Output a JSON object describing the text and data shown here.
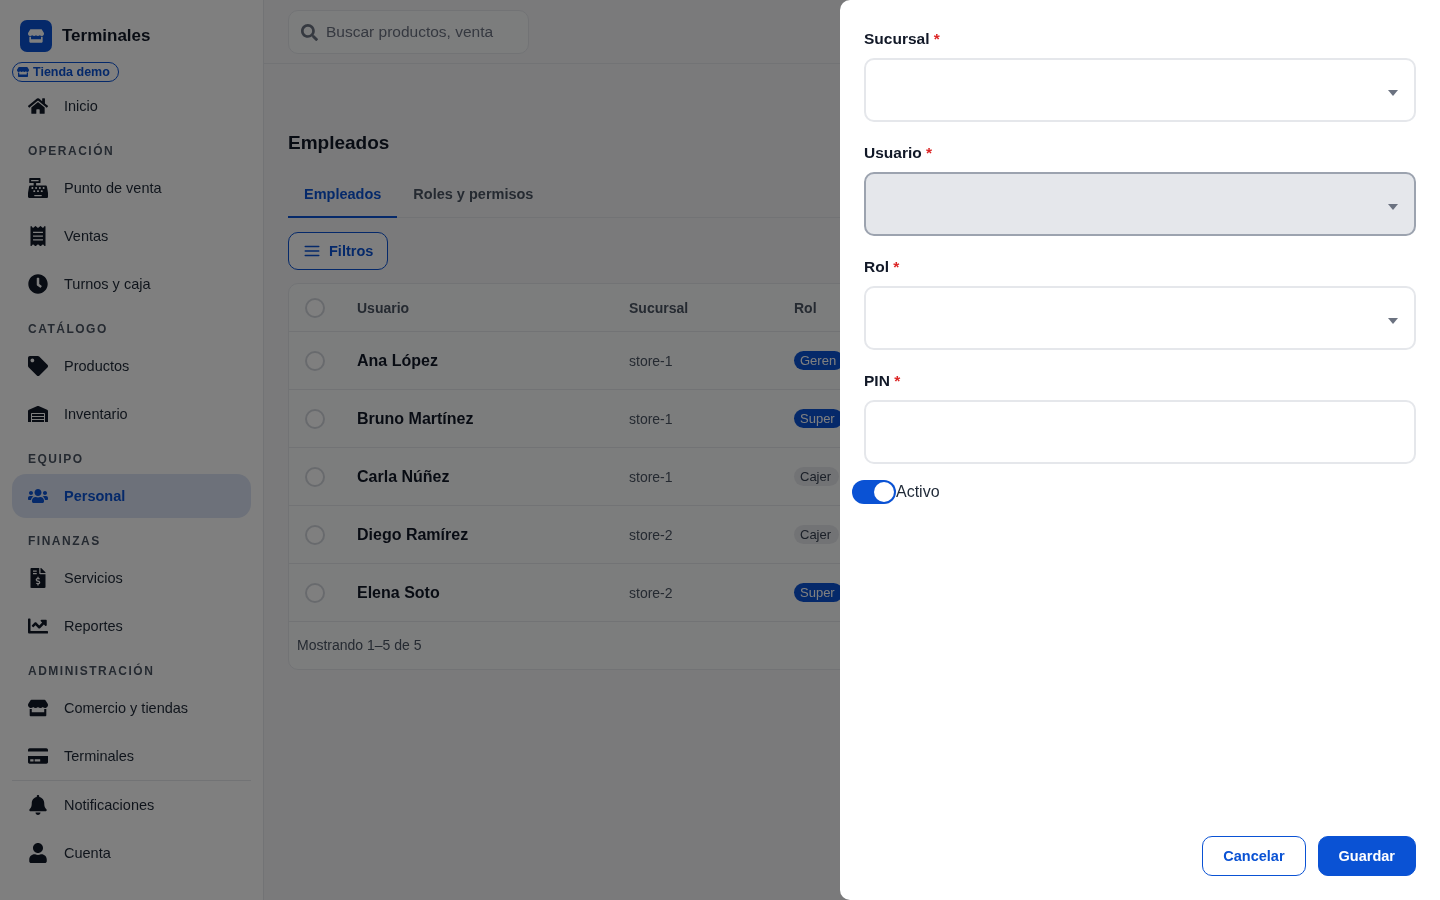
{
  "sidebar": {
    "brand": "Terminales",
    "store_chip": "Tienda demo",
    "top_items": [
      {
        "label": "Inicio",
        "selected": false
      }
    ],
    "sections": [
      {
        "heading": "OPERACIÓN",
        "items": [
          {
            "label": "Punto de venta",
            "selected": false
          },
          {
            "label": "Ventas",
            "selected": false
          },
          {
            "label": "Turnos y caja",
            "selected": false
          }
        ]
      },
      {
        "heading": "CATÁLOGO",
        "items": [
          {
            "label": "Productos",
            "selected": false
          },
          {
            "label": "Inventario",
            "selected": false
          }
        ]
      },
      {
        "heading": "EQUIPO",
        "items": [
          {
            "label": "Personal",
            "selected": true
          }
        ]
      },
      {
        "heading": "FINANZAS",
        "items": [
          {
            "label": "Servicios",
            "selected": false
          },
          {
            "label": "Reportes",
            "selected": false
          }
        ]
      },
      {
        "heading": "ADMINISTRACIÓN",
        "items": [
          {
            "label": "Comercio y tiendas",
            "selected": false
          },
          {
            "label": "Terminales",
            "selected": false
          }
        ]
      }
    ],
    "bottom_items": [
      {
        "label": "Notificaciones",
        "selected": false
      },
      {
        "label": "Cuenta",
        "selected": false
      }
    ]
  },
  "search": {
    "placeholder": "Buscar productos, venta"
  },
  "page_title": "Empleados",
  "tabs": [
    {
      "label": "Empleados",
      "selected": true
    },
    {
      "label": "Roles y permisos",
      "selected": false
    }
  ],
  "filter_button": "Filtros",
  "table": {
    "columns": [
      "Usuario",
      "Sucursal",
      "Rol"
    ],
    "select_all_checked": false,
    "rows": [
      {
        "name": "Ana López",
        "branch": "store-1",
        "role": {
          "label": "Geren",
          "kind": "primary"
        },
        "checked": false
      },
      {
        "name": "Bruno Martínez",
        "branch": "store-1",
        "role": {
          "label": "Super",
          "kind": "primary"
        },
        "checked": false
      },
      {
        "name": "Carla Núñez",
        "branch": "store-1",
        "role": {
          "label": "Cajer",
          "kind": "neutral"
        },
        "checked": false
      },
      {
        "name": "Diego Ramírez",
        "branch": "store-2",
        "role": {
          "label": "Cajer",
          "kind": "neutral"
        },
        "checked": false
      },
      {
        "name": "Elena Soto",
        "branch": "store-2",
        "role": {
          "label": "Super",
          "kind": "primary"
        },
        "checked": false
      }
    ],
    "footer": "Mostrando 1–5 de 5"
  },
  "drawer": {
    "fields": [
      {
        "label": "Sucursal",
        "required": true,
        "marker": "*",
        "kind": "select",
        "disabled": false
      },
      {
        "label": "Usuario",
        "required": true,
        "marker": "*",
        "kind": "select",
        "disabled": true
      },
      {
        "label": "Rol",
        "required": true,
        "marker": "*",
        "kind": "select",
        "disabled": false
      },
      {
        "label": "PIN",
        "required": true,
        "marker": "*",
        "kind": "text",
        "disabled": false
      }
    ],
    "toggle": {
      "label": "Activo",
      "on": true
    },
    "buttons": [
      {
        "label": "Cancelar",
        "kind": "secondary"
      },
      {
        "label": "Guardar",
        "kind": "primary"
      }
    ]
  }
}
